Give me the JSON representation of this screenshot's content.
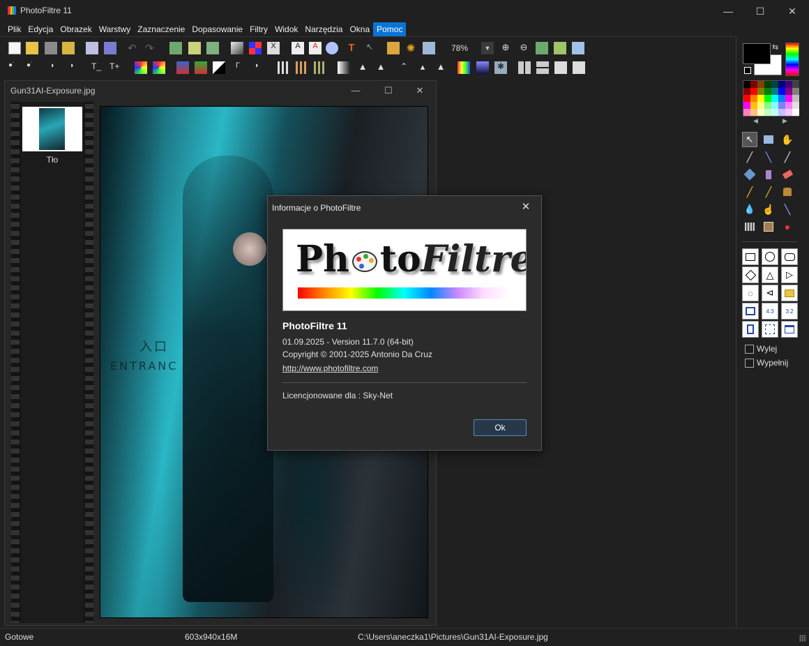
{
  "window": {
    "title": "PhotoFiltre 11",
    "minimize": "—",
    "maximize": "☐",
    "close": "✕"
  },
  "menu": [
    "Plik",
    "Edycja",
    "Obrazek",
    "Warstwy",
    "Zaznaczenie",
    "Dopasowanie",
    "Filtry",
    "Widok",
    "Narzędzia",
    "Okna",
    "Pomoc"
  ],
  "menu_active": "Pomoc",
  "toolbar": {
    "zoom_value": "78%",
    "zoom_dropdown": "▼"
  },
  "palette": {
    "swap_glyph": "⇆",
    "left_arrow": "◀",
    "right_arrow": "▶",
    "swatch_colors": [
      "#000000",
      "#800000",
      "#804000",
      "#004000",
      "#004040",
      "#000080",
      "#400080",
      "#404040",
      "#800000",
      "#ff0000",
      "#808000",
      "#008000",
      "#008080",
      "#0000ff",
      "#800080",
      "#808080",
      "#ff0000",
      "#ff8000",
      "#ffff00",
      "#00ff00",
      "#00ffff",
      "#0080ff",
      "#ff00ff",
      "#c0c0c0",
      "#ff00ff",
      "#ffc000",
      "#ffff80",
      "#80ff80",
      "#80ffff",
      "#8080ff",
      "#ff80ff",
      "#e0e0e0",
      "#ff80c0",
      "#ffc080",
      "#ffffc0",
      "#c0ffc0",
      "#c0ffff",
      "#c0c0ff",
      "#ffc0ff",
      "#ffffff"
    ],
    "check_wylej": "Wylej",
    "check_wypelnij": "Wypełnij"
  },
  "document": {
    "title": "Gun31AI-Exposure.jpg",
    "min": "—",
    "max": "☐",
    "close": "✕",
    "layer_label": "Tło",
    "canvas_text_1": "入口",
    "canvas_text_2": "ENTRANC"
  },
  "dialog": {
    "title": "Informacje o PhotoFiltre",
    "close": "✕",
    "logo_part1": "Ph",
    "logo_part2": "to",
    "logo_part3": "Filtre",
    "app_name": "PhotoFiltre 11",
    "version_line": "01.09.2025 - Version 11.7.0 (64-bit)",
    "copyright_line": "Copyright © 2001-2025 Antonio Da Cruz",
    "url": "http://www.photofiltre.com",
    "license_line": "Licencjonowane dla : Sky-Net",
    "ok_label": "Ok"
  },
  "status": {
    "state": "Gotowe",
    "dimensions": "603x940x16M",
    "path": "C:\\Users\\aneczka1\\Pictures\\Gun31AI-Exposure.jpg"
  }
}
